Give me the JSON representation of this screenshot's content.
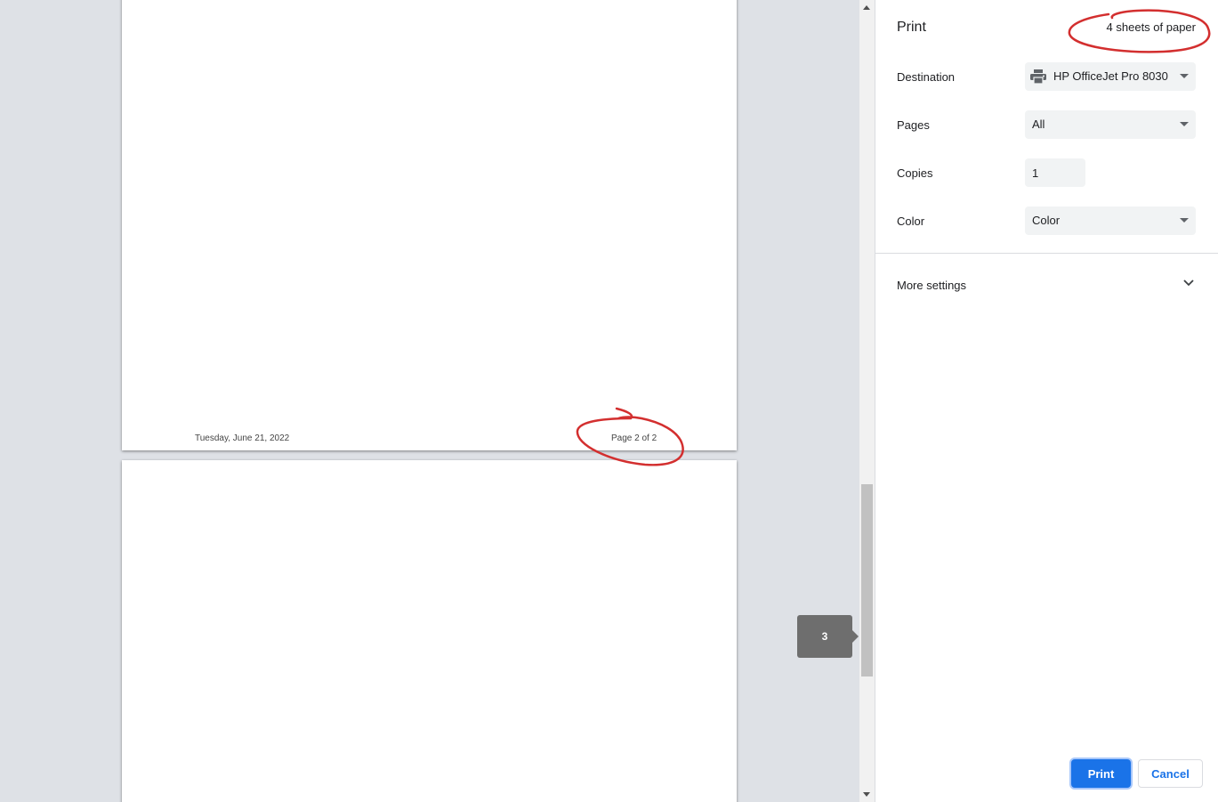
{
  "preview": {
    "footer_date": "Tuesday, June 21, 2022",
    "footer_page": "Page 2 of 2",
    "page_bubble": "3"
  },
  "sidebar": {
    "title": "Print",
    "sheet_summary": "4 sheets of paper",
    "destination": {
      "label": "Destination",
      "value": "HP OfficeJet Pro 8030",
      "icon": "printer-icon"
    },
    "pages": {
      "label": "Pages",
      "value": "All"
    },
    "copies": {
      "label": "Copies",
      "value": "1"
    },
    "color": {
      "label": "Color",
      "value": "Color"
    },
    "more_settings": {
      "label": "More settings",
      "icon": "chevron-down-icon"
    }
  },
  "buttons": {
    "print": "Print",
    "cancel": "Cancel"
  },
  "colors": {
    "accent": "#1a73e8",
    "annotation": "#d32f2f",
    "preview_bg": "#dee1e6",
    "bubble": "#6e6e6e"
  }
}
